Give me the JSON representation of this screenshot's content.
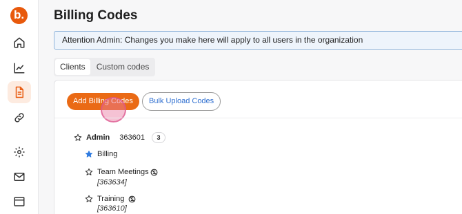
{
  "sidebar": {
    "logo_letter": "b.",
    "items": [
      {
        "icon": "home-icon"
      },
      {
        "icon": "chart-line-icon"
      },
      {
        "icon": "document-icon",
        "active": true
      },
      {
        "icon": "link-icon"
      },
      {
        "icon": "gear-icon"
      },
      {
        "icon": "mail-icon"
      },
      {
        "icon": "browser-window-icon"
      }
    ]
  },
  "page": {
    "title": "Billing Codes",
    "notice": "Attention Admin: Changes you make here will apply to all users in the organization"
  },
  "tabs": [
    {
      "label": "Clients",
      "active": true
    },
    {
      "label": "Custom codes",
      "active": false
    }
  ],
  "toolbar": {
    "add_label": "Add Billing Codes",
    "bulk_label": "Bulk Upload Codes"
  },
  "tree": {
    "client_name": "Admin",
    "client_code": "363601",
    "count": "3",
    "children": [
      {
        "name": "Billing",
        "code": "",
        "starred": true
      },
      {
        "name": "Team Meetings",
        "code": "[363634]",
        "starred": false
      },
      {
        "name": "Training",
        "code": "[363610]",
        "starred": false
      }
    ]
  },
  "colors": {
    "accent": "#ea6a15",
    "link_blue": "#2f6fd0",
    "notice_bg": "#eef4fb"
  }
}
